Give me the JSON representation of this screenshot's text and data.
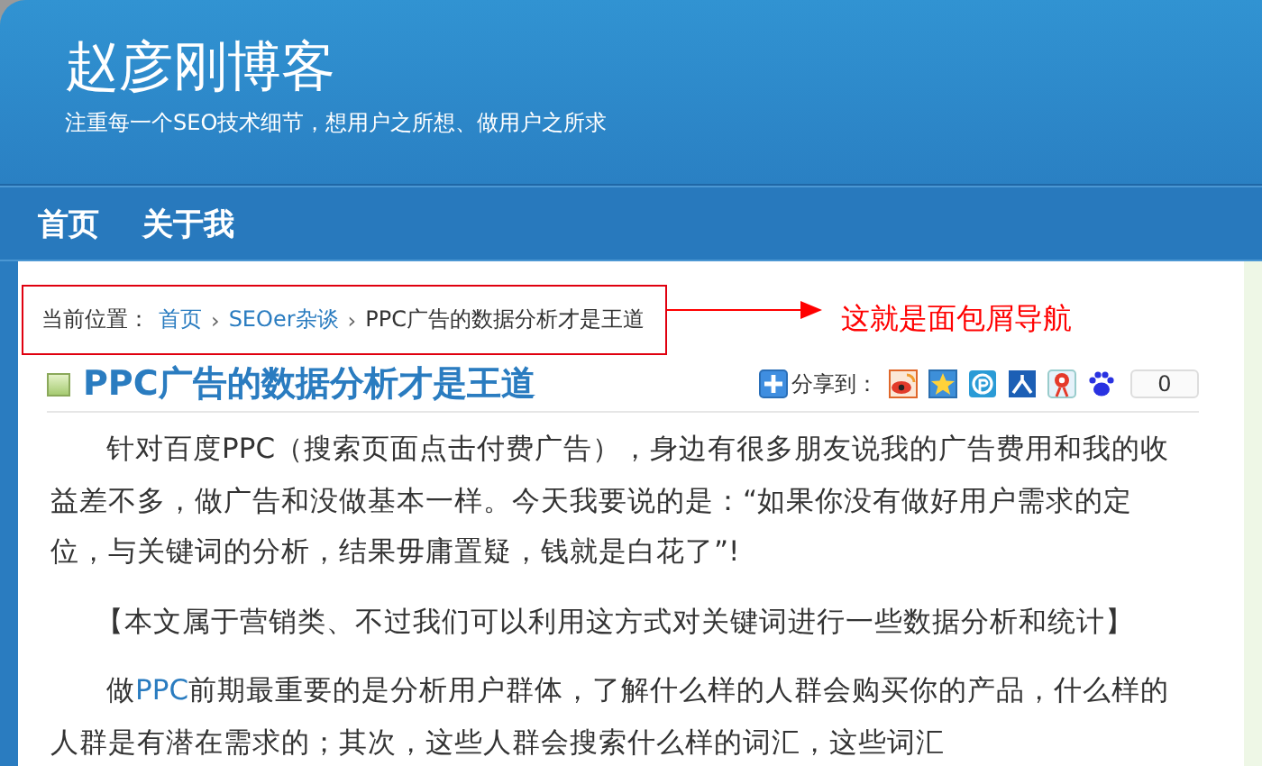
{
  "site": {
    "title": "赵彦刚博客",
    "tagline": "注重每一个SEO技术细节，想用户之所想、做用户之所求"
  },
  "nav": [
    {
      "label": "首页"
    },
    {
      "label": "关于我"
    }
  ],
  "breadcrumb": {
    "label": "当前位置：",
    "items": [
      {
        "kind": "link",
        "text": "首页"
      },
      {
        "kind": "separator",
        "text": "›"
      },
      {
        "kind": "link",
        "text": "SEOer杂谈"
      },
      {
        "kind": "separator",
        "text": "›"
      },
      {
        "kind": "current",
        "text": "PPC广告的数据分析才是王道"
      }
    ]
  },
  "annotation": {
    "text": "这就是面包屑导航"
  },
  "post": {
    "title": "PPC广告的数据分析才是王道",
    "share": {
      "label": "分享到：",
      "services": [
        {
          "kind": "weibo"
        },
        {
          "kind": "qzone"
        },
        {
          "kind": "pengyou"
        },
        {
          "kind": "renren"
        },
        {
          "kind": "tweibo"
        },
        {
          "kind": "baidu"
        }
      ],
      "count": "0"
    },
    "paragraphs": [
      {
        "kind": "indent",
        "segments": [
          {
            "kind": "text",
            "text": "针对百度PPC（搜索页面点击付费广告），身边有很多朋友说我的广告费用和我的收益差不多，做广告和没做基本一样。今天我要说的是：“如果你没有做好用户需求的定位，与关键词的分析，结果毋庸置疑，钱就是白花了”!"
          }
        ]
      },
      {
        "kind": "center",
        "segments": [
          {
            "kind": "text",
            "text": "【本文属于营销类、不过我们可以利用这方式对关键词进行一些数据分析和统计】"
          }
        ]
      },
      {
        "kind": "indent",
        "segments": [
          {
            "kind": "text",
            "text": "做"
          },
          {
            "kind": "link",
            "text": "PPC"
          },
          {
            "kind": "text",
            "text": "前期最重要的是分析用户群体，了解什么样的人群会购买你的产品，什么样的人群是有潜在需求的；其次，这些人群会搜索什么样的词汇，这些词汇"
          }
        ]
      }
    ]
  }
}
